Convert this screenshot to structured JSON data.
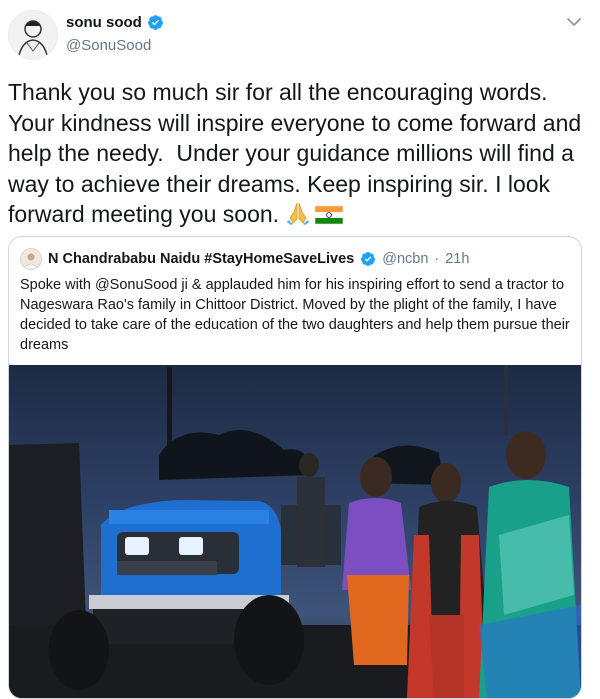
{
  "tweet": {
    "display_name": "sonu sood",
    "handle": "@SonuSood",
    "text": "Thank you so much sir for all the encouraging words. Your kindness will inspire everyone to come forward and help the needy.  Under your guidance millions will find a way to achieve their dreams. Keep inspiring sir. I look forward meeting you soon. ",
    "emojis": [
      "folded-hands-emoji",
      "india-flag-emoji"
    ]
  },
  "quoted_tweet": {
    "display_name": "N Chandrababu Naidu #StayHomeSaveLives",
    "handle": "@ncbn",
    "separator": "·",
    "time": "21h",
    "text": "Spoke with @SonuSood ji & applauded him for his inspiring effort to send a tractor to Nageswara Rao's family in Chittoor District. Moved by the plight of the family, I have decided to take care of the education of the two daughters and help them pursue their dreams"
  },
  "colors": {
    "verified_blue": "#1da1f2",
    "text": "#14171a",
    "secondary_text": "#657786",
    "border": "#ccd6dd"
  },
  "icons": [
    "verified-badge-icon",
    "chevron-down-icon"
  ]
}
